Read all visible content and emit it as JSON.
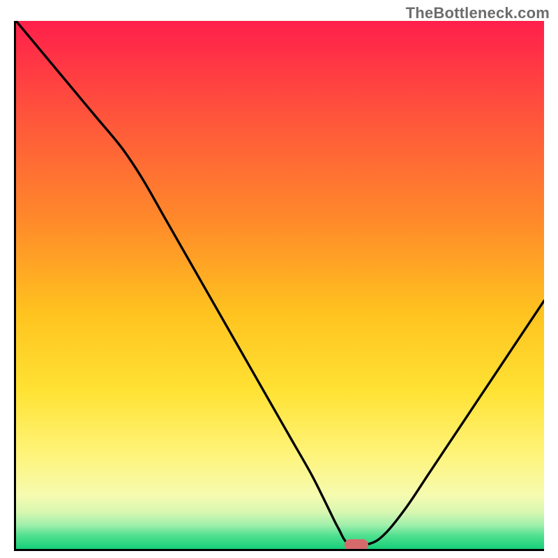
{
  "watermark": {
    "text": "TheBottleneck.com"
  },
  "chart_data": {
    "type": "line",
    "title": "",
    "xlabel": "",
    "ylabel": "",
    "x_range_pct": [
      0,
      100
    ],
    "y_range_pct": [
      0,
      100
    ],
    "series": [
      {
        "name": "bottleneck-curve",
        "x_pct": [
          0,
          5,
          10,
          15,
          20,
          24,
          28,
          32,
          36,
          40,
          44,
          48,
          52,
          56,
          59,
          61,
          63,
          67,
          70,
          74,
          78,
          82,
          86,
          90,
          94,
          98,
          100
        ],
        "y_pct": [
          100,
          94,
          88,
          82,
          76,
          70,
          63,
          56,
          49,
          42,
          35,
          28,
          21,
          14,
          8,
          4,
          1,
          1,
          3,
          8,
          14,
          20,
          26,
          32,
          38,
          44,
          47
        ]
      }
    ],
    "optimal_marker": {
      "x_pct": 64.5,
      "y_pct": 0.8,
      "color": "#d56a6d"
    },
    "gradient_stops": [
      {
        "offset": 0,
        "color": "#ff1f4b"
      },
      {
        "offset": 20,
        "color": "#ff5a3a"
      },
      {
        "offset": 38,
        "color": "#ff8a2a"
      },
      {
        "offset": 55,
        "color": "#ffc21f"
      },
      {
        "offset": 70,
        "color": "#ffe233"
      },
      {
        "offset": 82,
        "color": "#fff47a"
      },
      {
        "offset": 90,
        "color": "#f5fbb0"
      },
      {
        "offset": 93,
        "color": "#d8f7b0"
      },
      {
        "offset": 95.5,
        "color": "#9fefac"
      },
      {
        "offset": 97.5,
        "color": "#4fe08f"
      },
      {
        "offset": 100,
        "color": "#16d07a"
      }
    ],
    "axes_visible": true,
    "grid": false
  }
}
